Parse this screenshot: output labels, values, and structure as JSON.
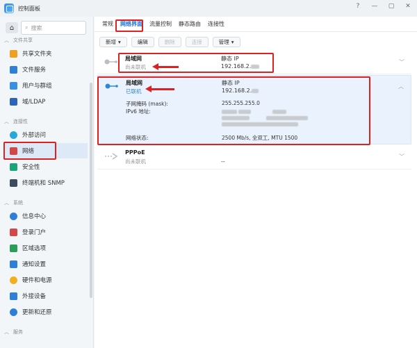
{
  "window": {
    "title": "控制面板",
    "controls": [
      "?",
      "—",
      "▢",
      "✕"
    ]
  },
  "sidebar": {
    "search_placeholder": "搜索",
    "sections": [
      {
        "label": "文件共享",
        "items": [
          {
            "label": "共享文件夹",
            "icon": "folder-share-icon",
            "color": "#f0a020"
          },
          {
            "label": "文件服务",
            "icon": "file-services-icon",
            "color": "#2f7fd6"
          },
          {
            "label": "用户与群组",
            "icon": "users-icon",
            "color": "#3a8fe0"
          },
          {
            "label": "域/LDAP",
            "icon": "domain-icon",
            "color": "#2e64b8"
          }
        ]
      },
      {
        "label": "连接性",
        "items": [
          {
            "label": "外部访问",
            "icon": "globe-icon",
            "color": "#28a8d8"
          },
          {
            "label": "网络",
            "icon": "network-icon",
            "color": "#d24848"
          },
          {
            "label": "安全性",
            "icon": "shield-icon",
            "color": "#1ca37a"
          },
          {
            "label": "终端机和 SNMP",
            "icon": "terminal-icon",
            "color": "#3b4b60"
          }
        ]
      },
      {
        "label": "系统",
        "items": [
          {
            "label": "信息中心",
            "icon": "info-icon",
            "color": "#2f7fd6"
          },
          {
            "label": "登录门户",
            "icon": "login-portal-icon",
            "color": "#d24848"
          },
          {
            "label": "区域选项",
            "icon": "region-icon",
            "color": "#2a9d5a"
          },
          {
            "label": "通知设置",
            "icon": "notification-icon",
            "color": "#2f7fd6"
          },
          {
            "label": "硬件和电源",
            "icon": "hardware-power-icon",
            "color": "#f0b020"
          },
          {
            "label": "外接设备",
            "icon": "external-device-icon",
            "color": "#2f7fd6"
          },
          {
            "label": "更新和还原",
            "icon": "update-restore-icon",
            "color": "#2f7fd6"
          }
        ]
      },
      {
        "label": "服务",
        "items": []
      }
    ]
  },
  "tabs": [
    "常规",
    "网络界面",
    "流量控制",
    "静态路由",
    "连接性"
  ],
  "toolbar": {
    "create": "新增",
    "edit": "编辑",
    "delete": "删除",
    "connect": "连接",
    "manage": "管理"
  },
  "interfaces": [
    {
      "name": "局域网",
      "status": "尚未联机",
      "type": "静态 IP",
      "ip": "192.168.2."
    },
    {
      "name": "局域网",
      "status": "已联机",
      "type": "静态 IP",
      "ip": "192.168.2.",
      "details": {
        "mask_label": "子网掩码 (mask):",
        "mask_value": "255.255.255.0",
        "ipv6_label": "IPv6 地址:",
        "net_status_label": "网络状态:",
        "net_status_value": "2500 Mb/s, 全双工, MTU 1500"
      }
    },
    {
      "name": "PPPoE",
      "status": "尚未联机",
      "type": "--"
    }
  ],
  "colors": {
    "accent": "#1b6fd6",
    "highlight": "#e02020"
  }
}
